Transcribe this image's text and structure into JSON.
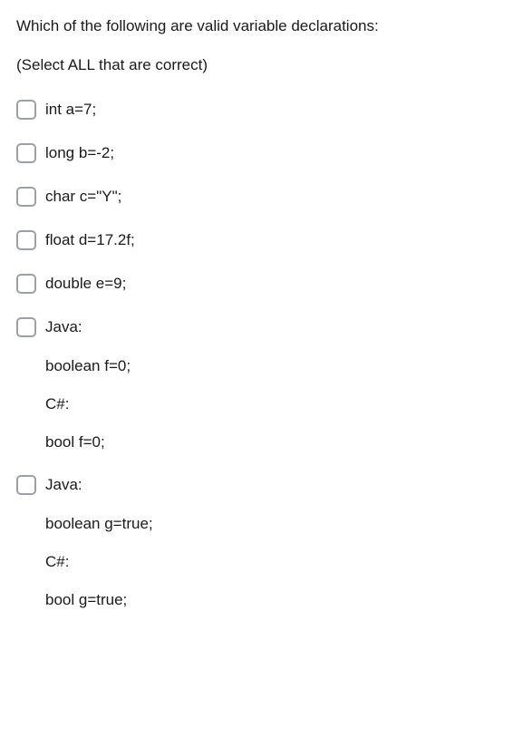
{
  "question": "Which of the following are valid variable declarations:",
  "instruction": "(Select ALL that are correct)",
  "options": [
    {
      "lines": [
        "int a=7;"
      ]
    },
    {
      "lines": [
        "long b=-2;"
      ]
    },
    {
      "lines": [
        "char c=\"Y\";"
      ]
    },
    {
      "lines": [
        "float d=17.2f;"
      ]
    },
    {
      "lines": [
        "double e=9;"
      ]
    },
    {
      "lines": [
        "Java:",
        "boolean f=0;",
        "C#:",
        "bool f=0;"
      ]
    },
    {
      "lines": [
        "Java:",
        "boolean g=true;",
        "C#:",
        "bool g=true;"
      ]
    }
  ]
}
